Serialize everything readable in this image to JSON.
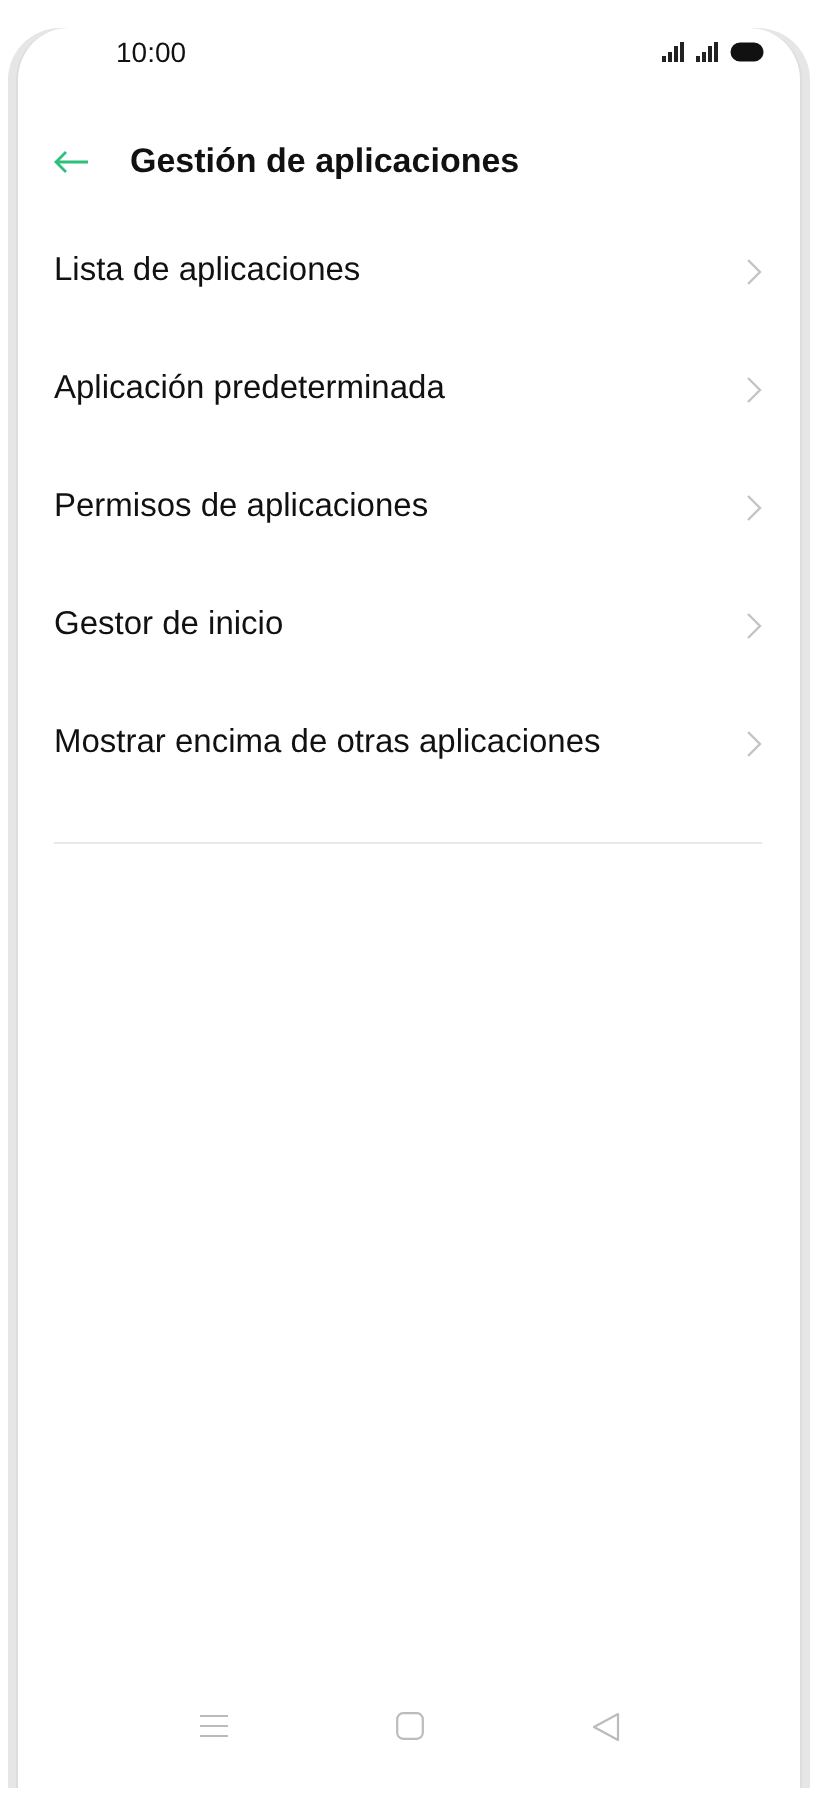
{
  "status_bar": {
    "time": "10:00"
  },
  "header": {
    "title": "Gestión de aplicaciones"
  },
  "items": [
    {
      "label": "Lista de aplicaciones"
    },
    {
      "label": "Aplicación predeterminada"
    },
    {
      "label": "Permisos de aplicaciones"
    },
    {
      "label": "Gestor de inicio"
    },
    {
      "label": "Mostrar encima de otras aplicaciones"
    }
  ]
}
